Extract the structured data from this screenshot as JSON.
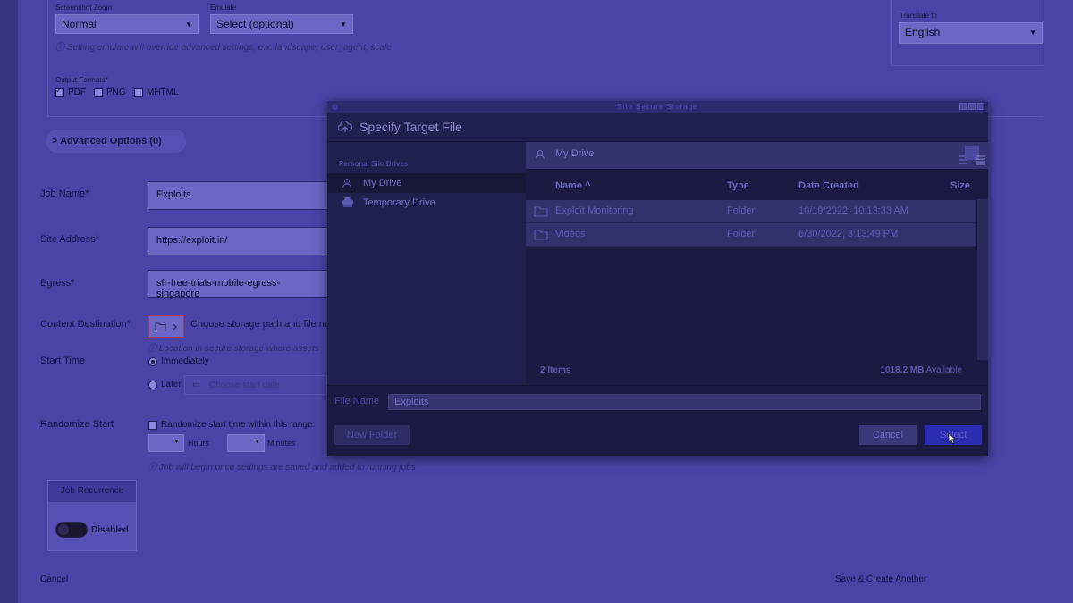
{
  "top_form": {
    "screenshot_zoom_label": "Screenshot Zoom",
    "screenshot_zoom_value": "Normal",
    "emulate_label": "Emulate",
    "emulate_value": "Select (optional)",
    "emulate_help": "ⓘ Setting emulate will override advanced settings, e.x. landscape, user_agent, scale",
    "translate_label": "Translate to",
    "translate_value": "English",
    "output_formats_label": "Output Formats*",
    "formats": [
      {
        "label": "PDF",
        "checked": true
      },
      {
        "label": "PNG",
        "checked": false
      },
      {
        "label": "MHTML",
        "checked": false
      }
    ],
    "advanced_options": "> Advanced Options (0)"
  },
  "form": {
    "job_name_label": "Job Name*",
    "job_name_value": "Exploits",
    "site_address_label": "Site Address*",
    "site_address_value": "https://exploit.in/",
    "egress_label": "Egress*",
    "egress_value": "sfr-free-trials-mobile-egress-singapore",
    "content_destination_label": "Content Destination*",
    "content_destination_text": "Choose storage path and file nar",
    "content_destination_help": "ⓘ Location in secure storage where assets",
    "start_time_label": "Start Time",
    "start_immediately": "Immediately",
    "start_later": "Later",
    "start_date_placeholder": "Choose start date",
    "randomize_label": "Randomize Start",
    "randomize_check": "Randomize start time within this range:",
    "hours": "Hours",
    "minutes": "Minutes",
    "randomize_help": "ⓘ Job will begin once settings are saved and added to running jobs",
    "job_recurrence": "Job Recurrence",
    "recurrence_state": "Disabled",
    "cancel": "Cancel",
    "save_create_another": "Save & Create Another"
  },
  "dialog": {
    "window_title": "Silo Secure Storage",
    "title": "Specify Target File",
    "sidebar_heading": "Personal Silo Drives",
    "drives": [
      "My Drive",
      "Temporary Drive"
    ],
    "path": "My Drive",
    "columns": [
      "Name ^",
      "Type",
      "Date Created",
      "Size"
    ],
    "rows": [
      {
        "name": "Exploit Monitoring",
        "type": "Folder",
        "date": "10/19/2022, 10:13:33 AM"
      },
      {
        "name": "Videos",
        "type": "Folder",
        "date": "6/30/2022, 3:13:49 PM"
      }
    ],
    "item_count": "2 Items",
    "available_size": "1018.2 MB",
    "available_word": "Available",
    "file_name_label": "File Name",
    "file_name_value": "Exploits",
    "new_folder": "New Folder",
    "cancel": "Cancel",
    "select": "Select"
  }
}
